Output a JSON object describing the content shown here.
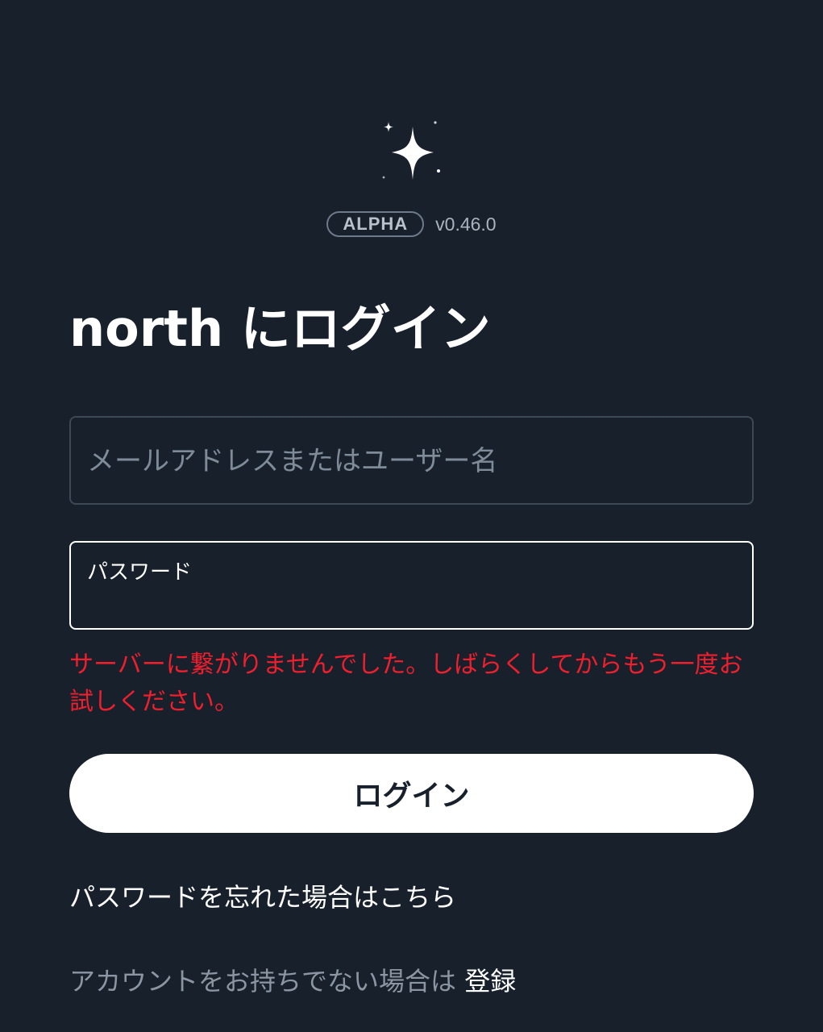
{
  "brand": {
    "logo_icon": "sparkle-icon",
    "badge": "ALPHA",
    "version": "v0.46.0"
  },
  "title": "north にログイン",
  "email_field": {
    "placeholder": "メールアドレスまたはユーザー名",
    "value": ""
  },
  "password_field": {
    "label": "パスワード",
    "value": ""
  },
  "error_message": "サーバーに繋がりませんでした。しばらくしてからもう一度お試しください。",
  "login_button": "ログイン",
  "forgot_password_link": "パスワードを忘れた場合はこちら",
  "signup": {
    "prompt": "アカウントをお持ちでない場合は",
    "link": "登録"
  },
  "colors": {
    "background": "#17202b",
    "error": "#f01f2e",
    "button_bg": "#ffffff",
    "muted_text": "#8c96a2"
  }
}
